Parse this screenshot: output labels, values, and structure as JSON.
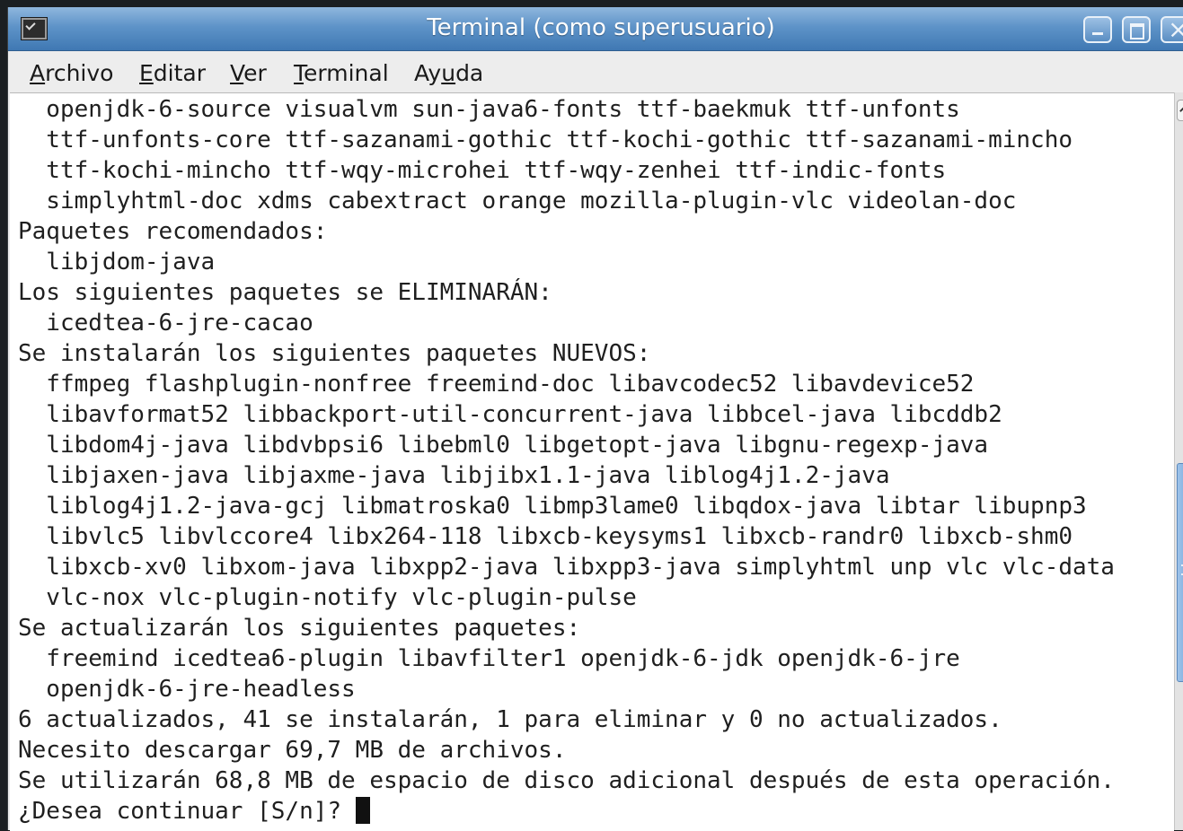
{
  "window": {
    "title": "Terminal (como superusuario)",
    "icon": "terminal-icon",
    "controls": [
      "minimize-icon",
      "maximize-icon",
      "close-icon"
    ]
  },
  "menubar": {
    "items": [
      {
        "mnemonic": "A",
        "rest": "rchivo",
        "full": "Archivo"
      },
      {
        "mnemonic": "E",
        "rest": "ditar",
        "full": "Editar"
      },
      {
        "mnemonic": "V",
        "rest": "er",
        "full": "Ver"
      },
      {
        "mnemonic": "T",
        "rest": "erminal",
        "full": "Terminal"
      },
      {
        "pre": "Ay",
        "mnemonic": "u",
        "rest": "da",
        "full": "Ayuda"
      }
    ]
  },
  "terminal": {
    "lines": [
      "  openjdk-6-source visualvm sun-java6-fonts ttf-baekmuk ttf-unfonts",
      "  ttf-unfonts-core ttf-sazanami-gothic ttf-kochi-gothic ttf-sazanami-mincho",
      "  ttf-kochi-mincho ttf-wqy-microhei ttf-wqy-zenhei ttf-indic-fonts",
      "  simplyhtml-doc xdms cabextract orange mozilla-plugin-vlc videolan-doc",
      "Paquetes recomendados:",
      "  libjdom-java",
      "Los siguientes paquetes se ELIMINARÁN:",
      "  icedtea-6-jre-cacao",
      "Se instalarán los siguientes paquetes NUEVOS:",
      "  ffmpeg flashplugin-nonfree freemind-doc libavcodec52 libavdevice52",
      "  libavformat52 libbackport-util-concurrent-java libbcel-java libcddb2",
      "  libdom4j-java libdvbpsi6 libebml0 libgetopt-java libgnu-regexp-java",
      "  libjaxen-java libjaxme-java libjibx1.1-java liblog4j1.2-java",
      "  liblog4j1.2-java-gcj libmatroska0 libmp3lame0 libqdox-java libtar libupnp3",
      "  libvlc5 libvlccore4 libx264-118 libxcb-keysyms1 libxcb-randr0 libxcb-shm0",
      "  libxcb-xv0 libxom-java libxpp2-java libxpp3-java simplyhtml unp vlc vlc-data",
      "  vlc-nox vlc-plugin-notify vlc-plugin-pulse",
      "Se actualizarán los siguientes paquetes:",
      "  freemind icedtea6-plugin libavfilter1 openjdk-6-jdk openjdk-6-jre",
      "  openjdk-6-jre-headless",
      "6 actualizados, 41 se instalarán, 1 para eliminar y 0 no actualizados.",
      "Necesito descargar 69,7 MB de archivos.",
      "Se utilizarán 68,8 MB de espacio de disco adicional después de esta operación."
    ],
    "prompt": "¿Desea continuar [S/n]? "
  },
  "scrollbar": {
    "position_fraction": 0.69
  }
}
